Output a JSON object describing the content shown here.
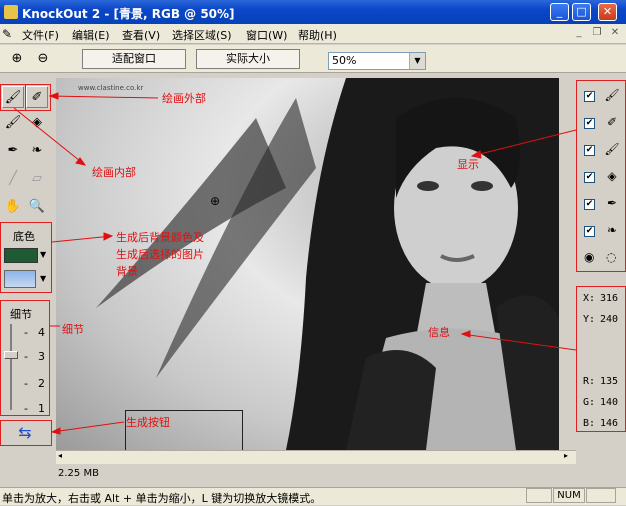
{
  "window": {
    "title": "KnockOut 2 - [青景, RGB @ 50%]"
  },
  "menu": {
    "items": [
      "文件(F)",
      "编辑(E)",
      "查看(V)",
      "选择区域(S)",
      "窗口(W)",
      "帮助(H)"
    ]
  },
  "toolbar": {
    "fit_window": "适配窗口",
    "actual_size": "实际大小",
    "zoom_value": "50%"
  },
  "left_panel": {
    "bg_color_label": "底色",
    "bg_color_value": "#1e5a32",
    "detail_label": "细节",
    "detail_ticks": [
      "4",
      "3",
      "2",
      "1"
    ],
    "detail_level": 3
  },
  "canvas": {
    "watermark": "www.clastine.co.kr"
  },
  "info": {
    "x_label": "X:",
    "x_value": "316",
    "y_label": "Y:",
    "y_value": "240",
    "r_label": "R:",
    "r_value": "135",
    "g_label": "G:",
    "g_value": "140",
    "b_label": "B:",
    "b_value": "146"
  },
  "annotations": {
    "outside": "绘画外部",
    "inside": "绘画内部",
    "display": "显示",
    "bg_note_1": "生成后背景颜色及",
    "bg_note_2": "生成后选择的图片",
    "bg_note_3": "背景",
    "detail": "细节",
    "info": "信息",
    "generate": "生成按钮"
  },
  "status": {
    "file_size": "2.25 MB",
    "hint": "单击为放大，右击或 Alt + 单击为缩小，L 键为切换放大镜模式。",
    "num": "NUM"
  }
}
